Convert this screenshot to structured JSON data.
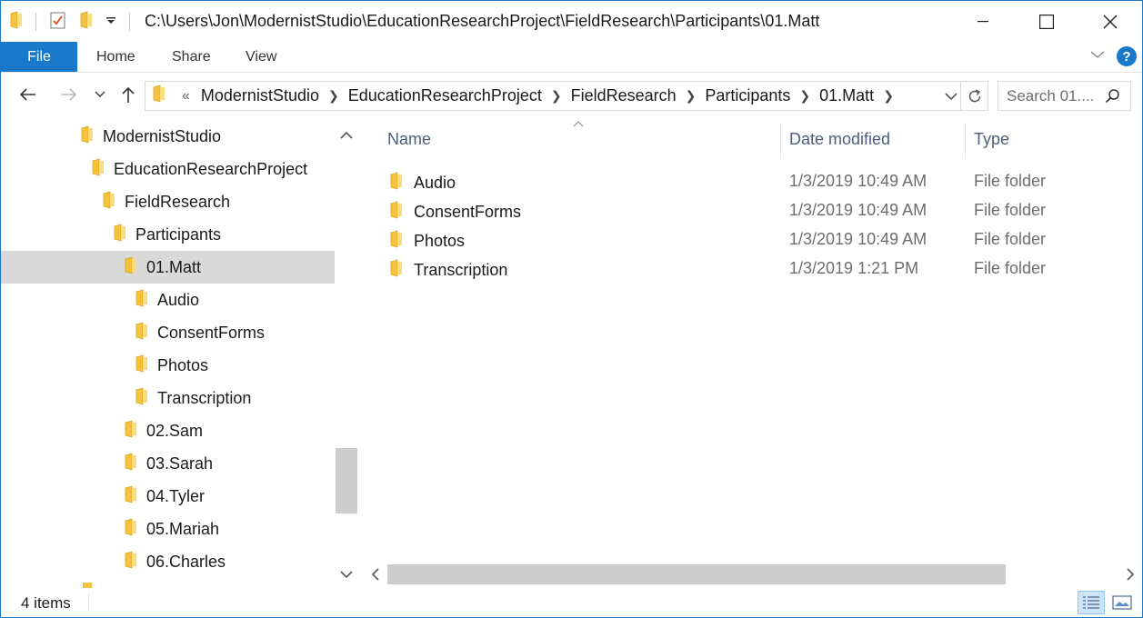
{
  "window": {
    "title_path": "C:\\Users\\Jon\\ModernistStudio\\EducationResearchProject\\FieldResearch\\Participants\\01.Matt"
  },
  "ribbon": {
    "tabs": [
      {
        "label": "File"
      },
      {
        "label": "Home"
      },
      {
        "label": "Share"
      },
      {
        "label": "View"
      }
    ]
  },
  "address": {
    "overflow": "«",
    "breadcrumbs": [
      "ModernistStudio",
      "EducationResearchProject",
      "FieldResearch",
      "Participants",
      "01.Matt"
    ]
  },
  "search": {
    "placeholder": "Search 01...."
  },
  "nav_tree": [
    {
      "label": "ModernistStudio",
      "level": 0
    },
    {
      "label": "EducationResearchProject",
      "level": 1
    },
    {
      "label": "FieldResearch",
      "level": 2
    },
    {
      "label": "Participants",
      "level": 3
    },
    {
      "label": "01.Matt",
      "level": 4,
      "selected": true
    },
    {
      "label": "Audio",
      "level": 5
    },
    {
      "label": "ConsentForms",
      "level": 5
    },
    {
      "label": "Photos",
      "level": 5
    },
    {
      "label": "Transcription",
      "level": 5
    },
    {
      "label": "02.Sam",
      "level": 4
    },
    {
      "label": "03.Sarah",
      "level": 4
    },
    {
      "label": "04.Tyler",
      "level": 4
    },
    {
      "label": "05.Mariah",
      "level": 4
    },
    {
      "label": "06.Charles",
      "level": 4
    }
  ],
  "columns": {
    "name": "Name",
    "date_modified": "Date modified",
    "type": "Type"
  },
  "files": [
    {
      "name": "Audio",
      "date": "1/3/2019 10:49 AM",
      "type": "File folder"
    },
    {
      "name": "ConsentForms",
      "date": "1/3/2019 10:49 AM",
      "type": "File folder"
    },
    {
      "name": "Photos",
      "date": "1/3/2019 10:49 AM",
      "type": "File folder"
    },
    {
      "name": "Transcription",
      "date": "1/3/2019 1:21 PM",
      "type": "File folder"
    }
  ],
  "status": {
    "item_count": "4 items"
  },
  "colors": {
    "accent": "#1979ca",
    "folder": "#f5c342",
    "selection": "#d9d9d9",
    "header_text": "#4c607a"
  }
}
